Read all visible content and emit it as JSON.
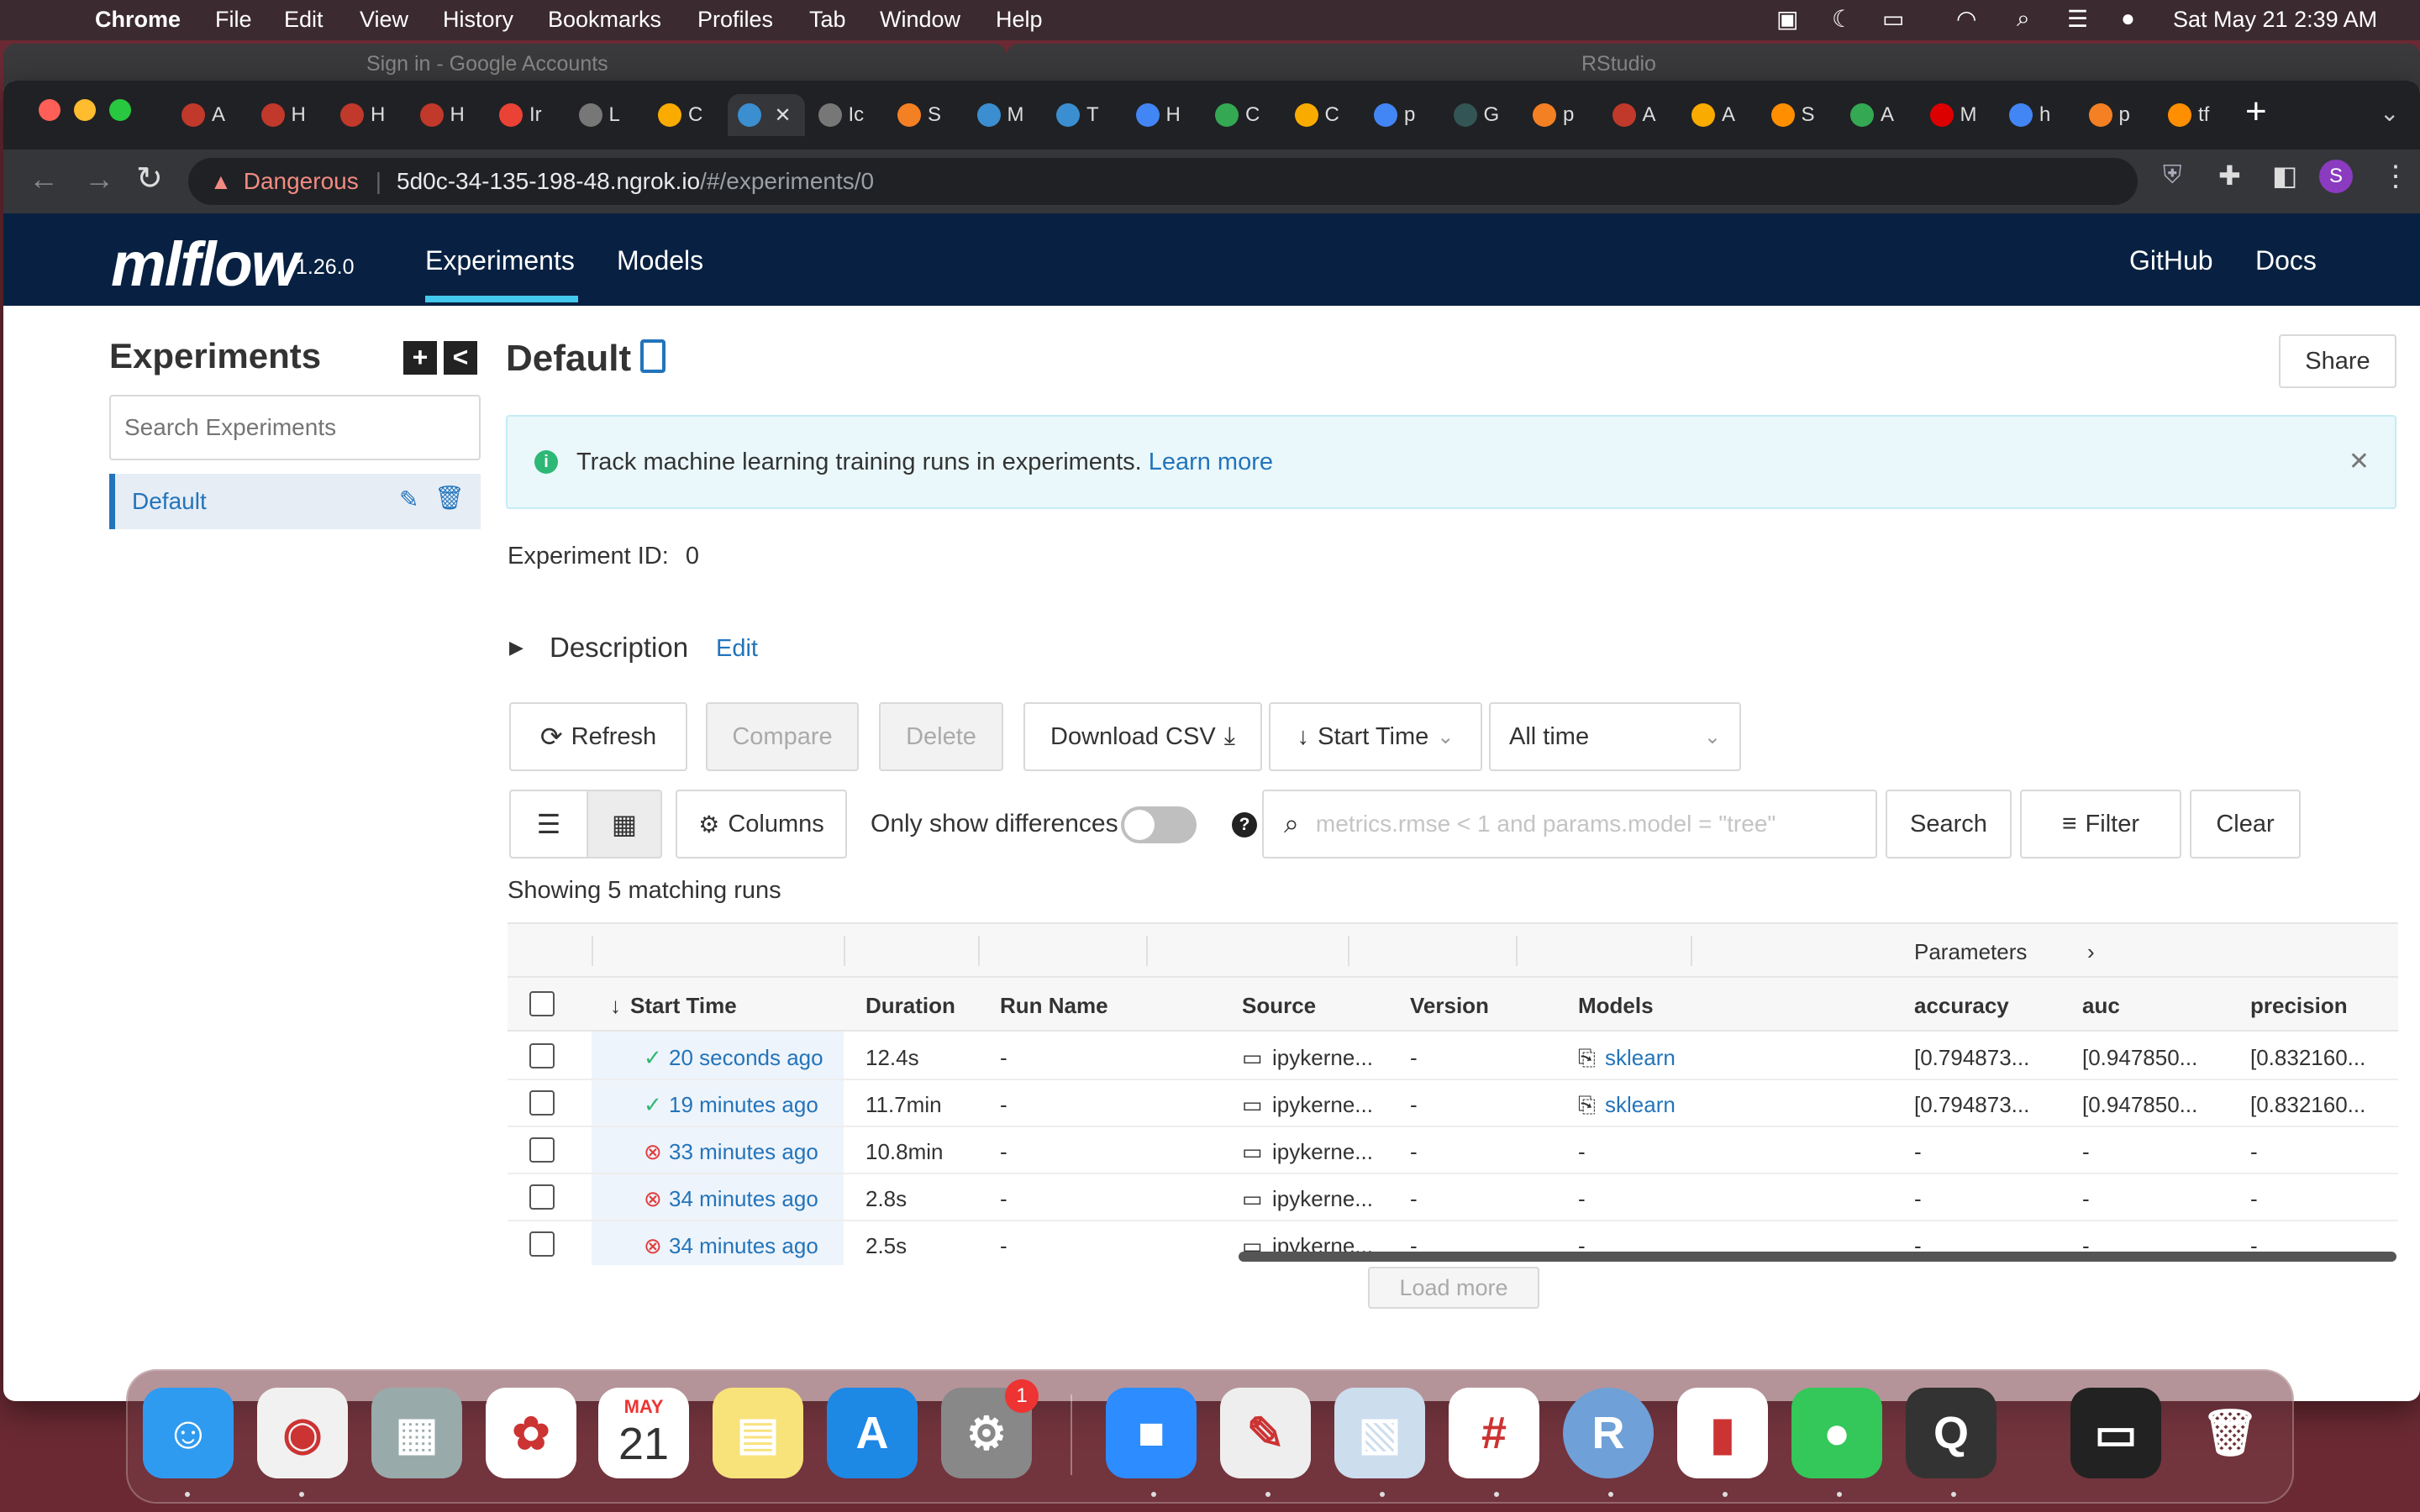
{
  "menubar": {
    "app": "Chrome",
    "items": [
      "File",
      "Edit",
      "View",
      "History",
      "Bookmarks",
      "Profiles",
      "Tab",
      "Window",
      "Help"
    ],
    "datetime": "Sat May 21  2:39 AM"
  },
  "background_windows": {
    "left_title": "Sign in - Google Accounts",
    "right_title": "RStudio"
  },
  "browser": {
    "tabs": [
      {
        "letter": "A",
        "icon": "red-gear-icon"
      },
      {
        "letter": "H",
        "icon": "red-gear-icon"
      },
      {
        "letter": "H",
        "icon": "red-gear-icon"
      },
      {
        "letter": "H",
        "icon": "red-gear-icon"
      },
      {
        "letter": "Ir",
        "icon": "gmail-icon"
      },
      {
        "letter": "L",
        "icon": "globe-icon"
      },
      {
        "letter": "C",
        "icon": "colab-icon"
      },
      {
        "letter": "",
        "icon": "mlflow-icon"
      },
      {
        "letter": "Ic",
        "icon": "globe-icon"
      },
      {
        "letter": "S",
        "icon": "stackoverflow-icon"
      },
      {
        "letter": "M",
        "icon": "mlflow-icon"
      },
      {
        "letter": "T",
        "icon": "mlflow-icon"
      },
      {
        "letter": "H",
        "icon": "google-icon"
      },
      {
        "letter": "C",
        "icon": "drive-icon"
      },
      {
        "letter": "C",
        "icon": "colab-icon"
      },
      {
        "letter": "p",
        "icon": "google-icon"
      },
      {
        "letter": "G",
        "icon": "tds-icon"
      },
      {
        "letter": "p",
        "icon": "stackoverflow-icon"
      },
      {
        "letter": "A",
        "icon": "red-gear-icon"
      },
      {
        "letter": "A",
        "icon": "colab-icon"
      },
      {
        "letter": "S",
        "icon": "tensorflow-icon"
      },
      {
        "letter": "A",
        "icon": "drive-icon"
      },
      {
        "letter": "M",
        "icon": "k-icon"
      },
      {
        "letter": "h",
        "icon": "google-icon"
      },
      {
        "letter": "p",
        "icon": "stackoverflow-icon"
      },
      {
        "letter": "tf",
        "icon": "tensorflow-icon"
      }
    ],
    "security_label": "Dangerous",
    "url_host": "5d0c-34-135-198-48.ngrok.io",
    "url_path": "/#/experiments/0",
    "profile_initial": "S"
  },
  "header": {
    "logo_text": "mlflow",
    "version": "1.26.0",
    "nav": [
      "Experiments",
      "Models"
    ],
    "right_links": [
      "GitHub",
      "Docs"
    ]
  },
  "sidebar": {
    "title": "Experiments",
    "search_placeholder": "Search Experiments",
    "items": [
      {
        "label": "Default"
      }
    ]
  },
  "main": {
    "title": "Default",
    "share_label": "Share",
    "banner_text": "Track machine learning training runs in experiments.",
    "banner_link": "Learn more",
    "experiment_id_label": "Experiment ID:",
    "experiment_id_value": "0",
    "description_label": "Description",
    "description_edit": "Edit",
    "buttons": {
      "refresh": "Refresh",
      "compare": "Compare",
      "delete": "Delete",
      "download_csv": "Download CSV",
      "sort": "Start Time",
      "time_range": "All time",
      "columns": "Columns",
      "search": "Search",
      "filter": "Filter",
      "clear": "Clear"
    },
    "only_show_differences": "Only show differences",
    "search_placeholder": "metrics.rmse < 1 and params.model = \"tree\"",
    "showing_text": "Showing 5 matching runs",
    "load_more": "Load more"
  },
  "table": {
    "group_header": "Parameters",
    "columns": [
      "Start Time",
      "Duration",
      "Run Name",
      "Source",
      "Version",
      "Models",
      "accuracy",
      "auc",
      "precision"
    ],
    "rows": [
      {
        "status": "finished",
        "start_time": "20 seconds ago",
        "duration": "12.4s",
        "run_name": "-",
        "source": "ipykerne...",
        "version": "-",
        "models": "sklearn",
        "accuracy": "[0.794873...",
        "auc": "[0.947850...",
        "precision": "[0.832160..."
      },
      {
        "status": "finished",
        "start_time": "19 minutes ago",
        "duration": "11.7min",
        "run_name": "-",
        "source": "ipykerne...",
        "version": "-",
        "models": "sklearn",
        "accuracy": "[0.794873...",
        "auc": "[0.947850...",
        "precision": "[0.832160..."
      },
      {
        "status": "failed",
        "start_time": "33 minutes ago",
        "duration": "10.8min",
        "run_name": "-",
        "source": "ipykerne...",
        "version": "-",
        "models": "-",
        "accuracy": "-",
        "auc": "-",
        "precision": "-"
      },
      {
        "status": "failed",
        "start_time": "34 minutes ago",
        "duration": "2.8s",
        "run_name": "-",
        "source": "ipykerne...",
        "version": "-",
        "models": "-",
        "accuracy": "-",
        "auc": "-",
        "precision": "-"
      },
      {
        "status": "failed",
        "start_time": "34 minutes ago",
        "duration": "2.5s",
        "run_name": "-",
        "source": "ipykerne...",
        "version": "-",
        "models": "-",
        "accuracy": "-",
        "auc": "-",
        "precision": "-"
      }
    ]
  },
  "dock": {
    "calendar_month": "MAY",
    "calendar_day": "21",
    "settings_badge": "1",
    "apps": [
      "finder-icon",
      "chrome-icon",
      "launchpad-icon",
      "photos-icon",
      "calendar-icon",
      "notes-icon",
      "app-store-icon",
      "system-preferences-icon",
      "zoom-icon",
      "textedit-icon",
      "preview-icon",
      "slack-icon",
      "r-icon",
      "numbers-icon",
      "messages-icon",
      "quicktime-icon",
      "window-thumbnail-icon",
      "trash-icon"
    ],
    "r_label": "R"
  }
}
